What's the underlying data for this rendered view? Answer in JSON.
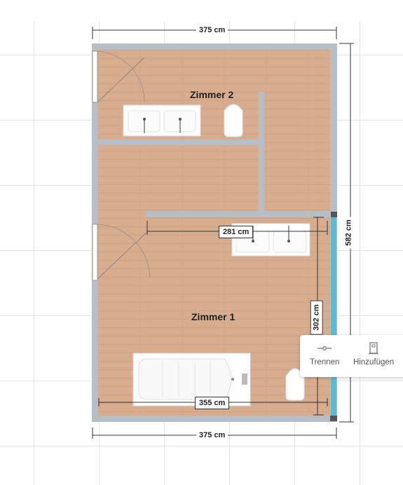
{
  "rooms": {
    "room2": {
      "label": "Zimmer 2"
    },
    "room1": {
      "label": "Zimmer 1"
    }
  },
  "dimensions": {
    "top_width": "375 cm",
    "bottom_width": "375 cm",
    "right_height": "582 cm",
    "inner_wall": "281 cm",
    "inner_height": "302 cm",
    "bathtub_width": "355 cm"
  },
  "toolbar": {
    "split_label": "Trennen",
    "add_label": "Hinzufügen"
  },
  "colors": {
    "floor": "#d8ad8d",
    "wall": "#b6bec6",
    "selected_wall": "#58bcd6"
  }
}
